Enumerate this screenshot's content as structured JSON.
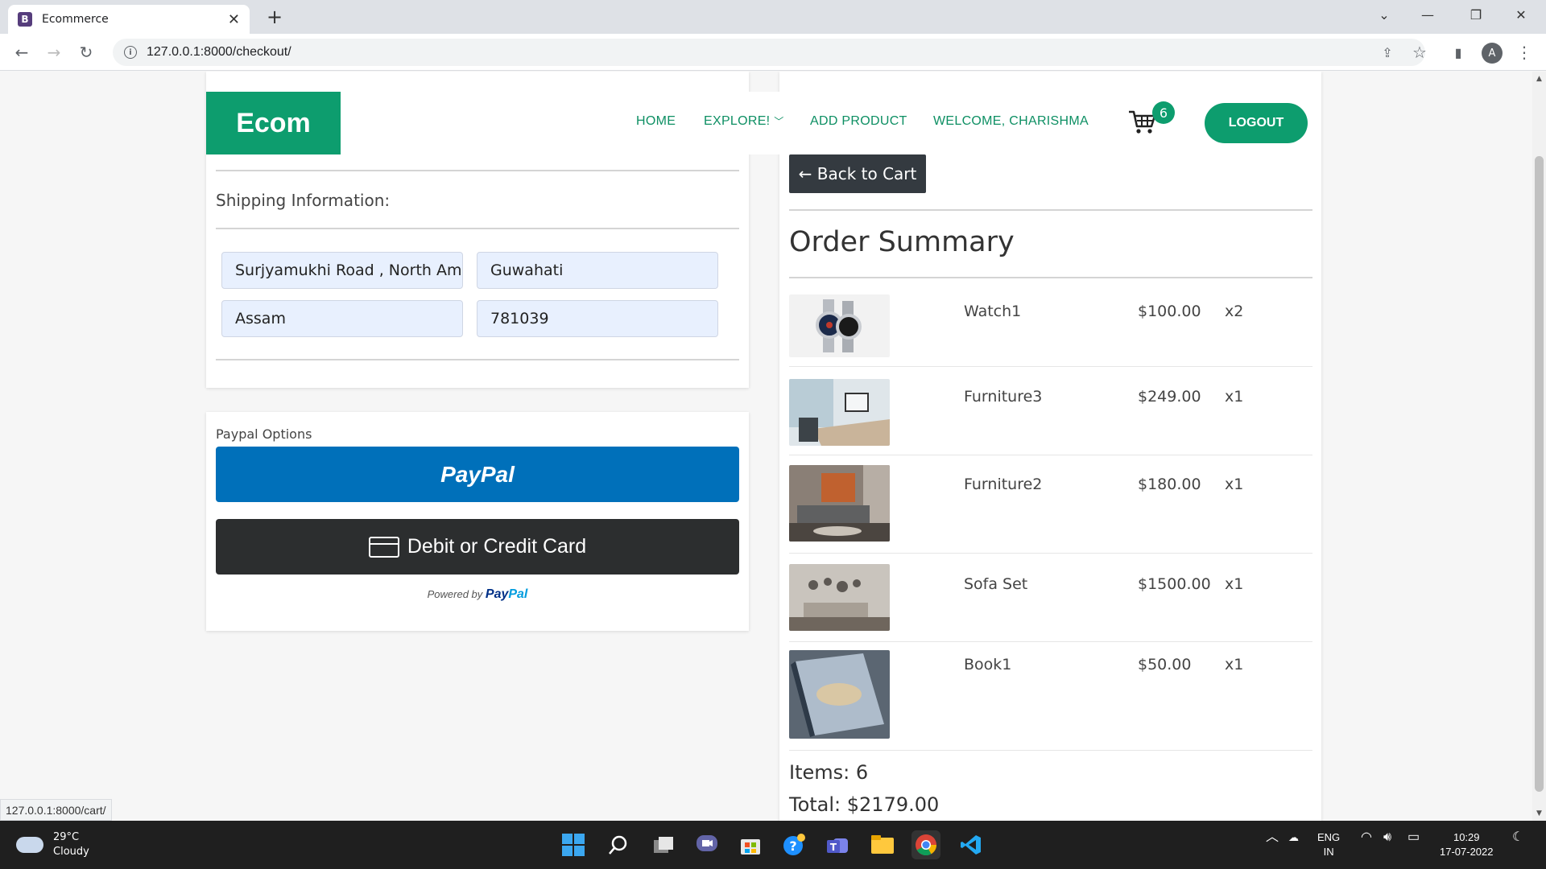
{
  "browser": {
    "tab_title": "Ecommerce",
    "favicon_letter": "B",
    "url": "127.0.0.1:8000/checkout/",
    "avatar_letter": "A",
    "status_url": "127.0.0.1:8000/cart/"
  },
  "navbar": {
    "brand": "Ecom",
    "links": [
      "HOME",
      "EXPLORE!",
      "ADD PRODUCT",
      "WELCOME, CHARISHMA"
    ],
    "cart_count": "6",
    "logout": "LOGOUT"
  },
  "shipping": {
    "title": "Shipping Information:",
    "address": "Surjyamukhi Road , North Amingaon",
    "city": "Guwahati",
    "state": "Assam",
    "zipcode": "781039"
  },
  "payment": {
    "label": "Paypal Options",
    "paypal_button": "PayPal",
    "card_button": "Debit or Credit Card",
    "powered_by": "Powered by",
    "powered_pay": "Pay",
    "powered_pal": "Pal"
  },
  "summary": {
    "back_button": "← Back to Cart",
    "title": "Order Summary",
    "items": [
      {
        "name": "Watch1",
        "price": "$100.00",
        "qty": "x2"
      },
      {
        "name": "Furniture3",
        "price": "$249.00",
        "qty": "x1"
      },
      {
        "name": "Furniture2",
        "price": "$180.00",
        "qty": "x1"
      },
      {
        "name": "Sofa Set",
        "price": "$1500.00",
        "qty": "x1"
      },
      {
        "name": "Book1",
        "price": "$50.00",
        "qty": "x1"
      }
    ],
    "items_count": "Items: 6",
    "total": "Total: $2179.00"
  },
  "taskbar": {
    "temperature": "29°C",
    "weather": "Cloudy",
    "lang": "ENG",
    "region": "IN",
    "time": "10:29",
    "date": "17-07-2022"
  },
  "colors": {
    "brand_green": "#0d9d6e",
    "paypal_blue": "#0070ba",
    "card_black": "#2c2e2f"
  }
}
